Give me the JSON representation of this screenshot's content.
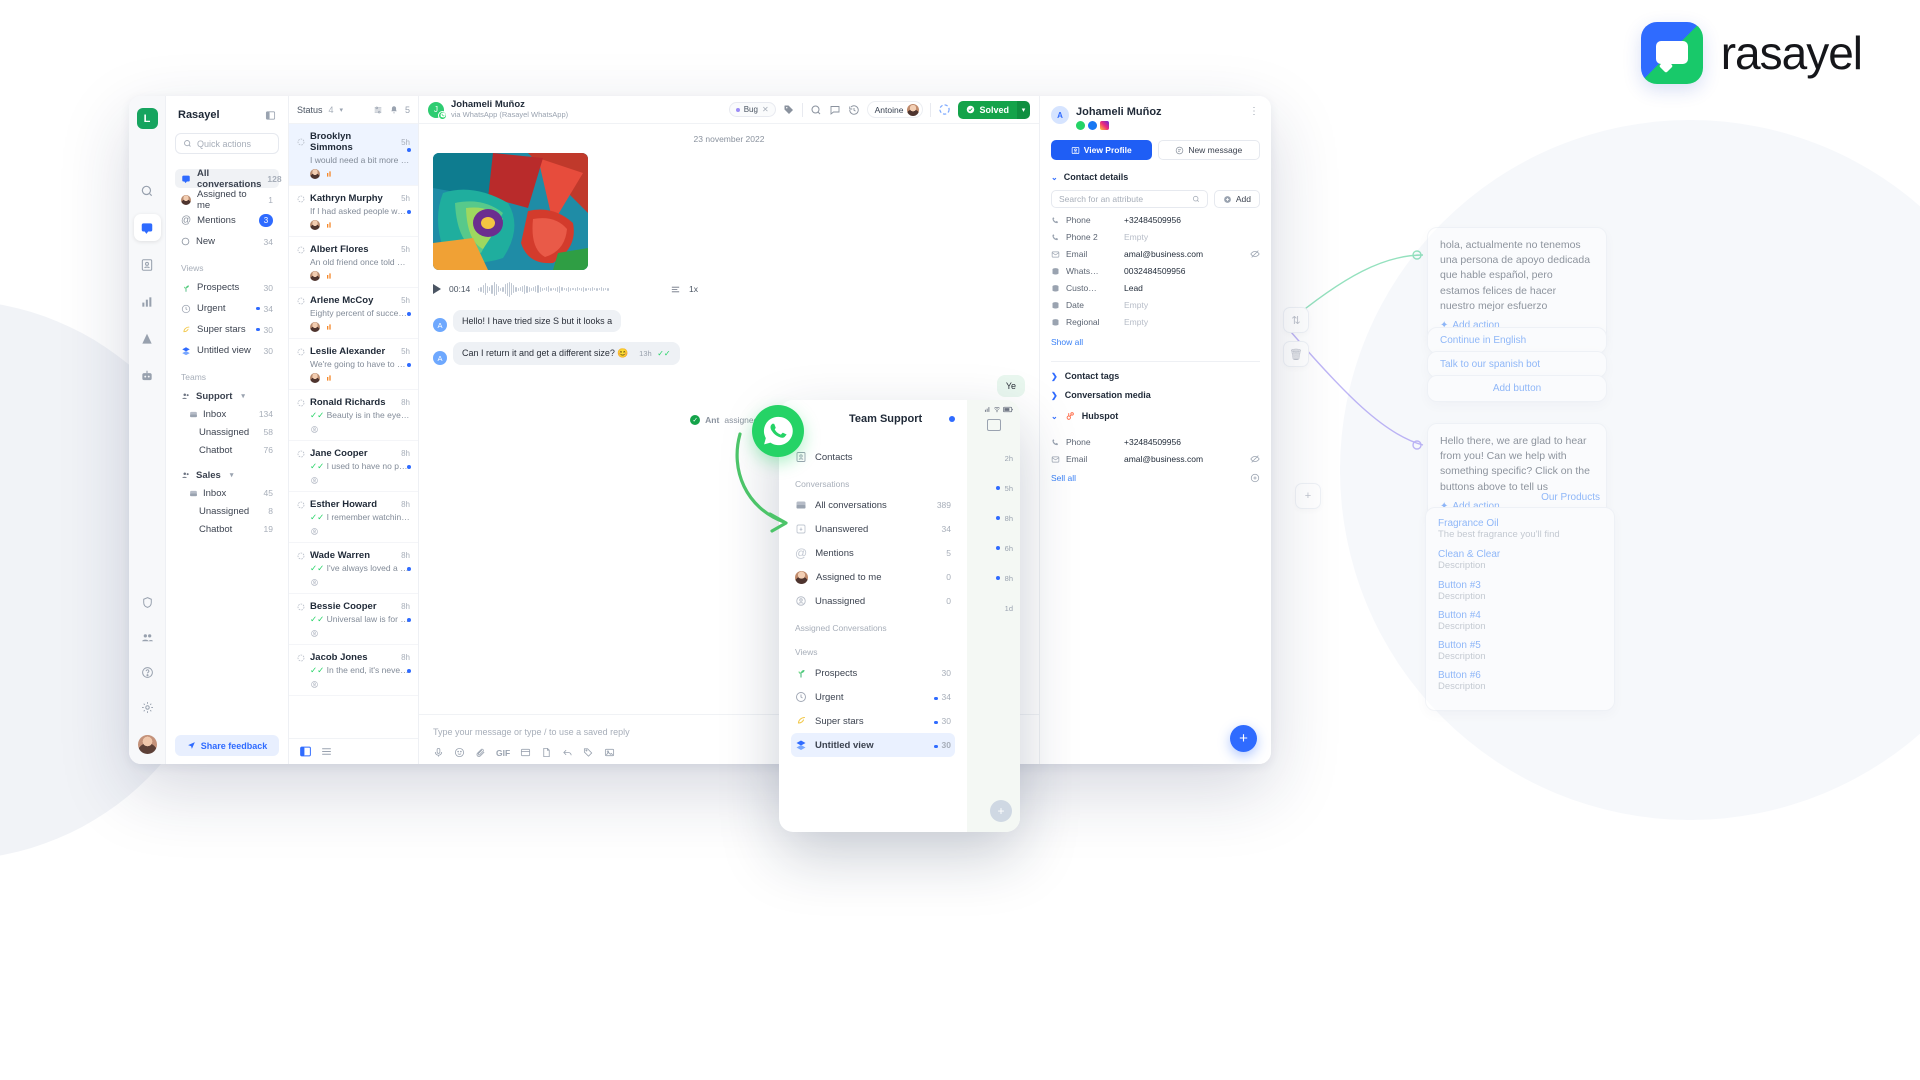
{
  "brand": {
    "name": "rasayel",
    "logo_letter": "L"
  },
  "rail": {
    "logo_letter": "L",
    "items": [
      {
        "name": "search-icon",
        "label": "Search"
      },
      {
        "name": "inbox-icon",
        "label": "Inbox",
        "active": true
      },
      {
        "name": "contacts-icon",
        "label": "Contacts"
      },
      {
        "name": "reports-icon",
        "label": "Reports"
      },
      {
        "name": "campaigns-icon",
        "label": "Campaigns"
      },
      {
        "name": "bot-icon",
        "label": "Bots"
      }
    ],
    "bottom": [
      {
        "name": "shield-icon",
        "label": "Privacy"
      },
      {
        "name": "team-icon",
        "label": "Team"
      },
      {
        "name": "help-icon",
        "label": "Help"
      },
      {
        "name": "gear-icon",
        "label": "Settings"
      }
    ]
  },
  "nav": {
    "title": "Rasayel",
    "collapse_icon": "panel-collapse-icon",
    "search_placeholder": "Quick actions",
    "primary": [
      {
        "label": "All conversations",
        "count": "128",
        "selected": true,
        "icon": "inbox-icon"
      },
      {
        "label": "Assigned to me",
        "count": "1",
        "icon": "avatar-icon"
      },
      {
        "label": "Mentions",
        "badge": "3",
        "icon": "at-icon"
      },
      {
        "label": "New",
        "count": "34",
        "icon": "circle-icon"
      }
    ],
    "views_label": "Views",
    "views": [
      {
        "label": "Prospects",
        "count": "30",
        "icon": "sprout-icon",
        "dot": false
      },
      {
        "label": "Urgent",
        "count": "34",
        "icon": "clock-icon",
        "dot": true
      },
      {
        "label": "Super stars",
        "count": "30",
        "icon": "comet-icon",
        "dot": true
      },
      {
        "label": "Untitled view",
        "count": "30",
        "icon": "layers-icon",
        "dot": false
      }
    ],
    "teams_label": "Teams",
    "teams": [
      {
        "name": "Support",
        "children": [
          {
            "label": "Inbox",
            "count": "134",
            "icon": "inbox-icon"
          },
          {
            "label": "Unassigned",
            "count": "58"
          },
          {
            "label": "Chatbot",
            "count": "76"
          }
        ]
      },
      {
        "name": "Sales",
        "children": [
          {
            "label": "Inbox",
            "count": "45",
            "icon": "inbox-icon"
          },
          {
            "label": "Unassigned",
            "count": "8"
          },
          {
            "label": "Chatbot",
            "count": "19"
          }
        ]
      }
    ],
    "feedback_label": "Share feedback"
  },
  "conversations": {
    "status_label": "Status",
    "status_count": "4",
    "filter_icon": "filter-icon",
    "bell_icon": "bell-icon",
    "bell_count": "5",
    "items": [
      {
        "name": "Brooklyn Simmons",
        "preview": "I would need a bit more information if that's…",
        "time": "5h",
        "active": true,
        "unread": true,
        "sent": false
      },
      {
        "name": "Kathryn Murphy",
        "preview": "If I had asked people what they wanted, the…",
        "time": "5h",
        "unread": true,
        "sent": false
      },
      {
        "name": "Albert Flores",
        "preview": "An old friend once told me something that…",
        "time": "5h",
        "unread": false,
        "sent": false
      },
      {
        "name": "Arlene McCoy",
        "preview": "Eighty percent of success is showing up",
        "time": "5h",
        "unread": true,
        "sent": false
      },
      {
        "name": "Leslie Alexander",
        "preview": "We're going to have to get jobs, to cover up…",
        "time": "5h",
        "unread": true,
        "sent": false
      },
      {
        "name": "Ronald Richards",
        "preview": "Beauty is in the eye of the beholder",
        "time": "8h",
        "unread": false,
        "sent": true
      },
      {
        "name": "Jane Cooper",
        "preview": "I used to have no pubic hair when this son…",
        "time": "8h",
        "unread": true,
        "sent": true
      },
      {
        "name": "Esther Howard",
        "preview": "I remember watching this footage when it…",
        "time": "8h",
        "unread": false,
        "sent": true
      },
      {
        "name": "Wade Warren",
        "preview": "I've always loved a good story. I believed…",
        "time": "8h",
        "unread": true,
        "sent": true
      },
      {
        "name": "Bessie Cooper",
        "preview": "Universal law is for lackeys, context is for…",
        "time": "8h",
        "unread": true,
        "sent": true
      },
      {
        "name": "Jacob Jones",
        "preview": "In the end, it's never what you worry abou…",
        "time": "8h",
        "unread": true,
        "sent": true
      }
    ]
  },
  "chat": {
    "contact_name": "Johameli Muñoz",
    "channel": "via WhatsApp (Rasayel WhatsApp)",
    "avatar_letter": "J",
    "tag": {
      "label": "Bug",
      "close_icon": "close-icon"
    },
    "toolbar_icons": [
      "tag-icon",
      "search-icon",
      "note-icon",
      "history-icon"
    ],
    "agent": {
      "name": "Antoine"
    },
    "refresh_icon": "loading-icon",
    "status_button": {
      "label": "Solved",
      "caret": "▾"
    },
    "date_divider": "23 november 2022",
    "voice": {
      "duration": "00:14",
      "speed": "1x"
    },
    "messages": [
      {
        "from": "in",
        "avatar": "A",
        "text": "Hello! I have tried size S but it looks a"
      },
      {
        "from": "in",
        "avatar": "A",
        "text": "Can I return it and get a different size? 😊",
        "time": "13h"
      },
      {
        "from": "out",
        "text": "Ye"
      }
    ],
    "system_note": {
      "bold": "Ant",
      "rest": "assigned th"
    },
    "composer_placeholder": "Type your message or type / to use a saved reply",
    "composer_icons": [
      "mic-icon",
      "emoji-icon",
      "attach-icon",
      "gif-icon",
      "template-icon",
      "doc-icon",
      "reply-icon",
      "tag-icon",
      "image-icon"
    ],
    "fab_icon": "plus-icon"
  },
  "contact_panel": {
    "name": "Johameli Muñoz",
    "avatar_letter": "A",
    "socials": [
      "whatsapp-icon",
      "facebook-icon",
      "instagram-icon"
    ],
    "menu_icon": "kebab-menu-icon",
    "view_profile": "View Profile",
    "new_message": "New message",
    "details_label": "Contact details",
    "attribute_search_placeholder": "Search for an attribute",
    "add_label": "Add",
    "attributes": [
      {
        "key": "Phone",
        "value": "+32484509956",
        "icon": "phone-icon"
      },
      {
        "key": "Phone 2",
        "value": "Empty",
        "empty": true,
        "icon": "phone-icon"
      },
      {
        "key": "Email",
        "value": "amal@business.com",
        "icon": "mail-icon",
        "eye": true
      },
      {
        "key": "Whats…",
        "value": "0032484509956",
        "icon": "db-icon"
      },
      {
        "key": "Custo…",
        "value": "Lead",
        "icon": "db-icon"
      },
      {
        "key": "Date",
        "value": "Empty",
        "empty": true,
        "icon": "db-icon"
      },
      {
        "key": "Regional",
        "value": "Empty",
        "empty": true,
        "icon": "db-icon"
      }
    ],
    "show_all": "Show all",
    "sections": [
      {
        "label": "Contact tags",
        "open": false
      },
      {
        "label": "Conversation media",
        "open": false
      }
    ],
    "hubspot": {
      "label": "Hubspot",
      "attributes": [
        {
          "key": "Phone",
          "value": "+32484509956",
          "icon": "phone-icon"
        },
        {
          "key": "Email",
          "value": "amal@business.com",
          "icon": "mail-icon",
          "eye": true
        }
      ],
      "sell_all": "Sell all"
    }
  },
  "overlay": {
    "title": "Team Support",
    "wa_icon": "whatsapp-icon",
    "contacts_label": "Contacts",
    "conversations_label": "Conversations",
    "conversations": [
      {
        "label": "All conversations",
        "count": "389",
        "icon": "inbox-icon"
      },
      {
        "label": "Unanswered",
        "count": "34",
        "icon": "unanswered-icon"
      },
      {
        "label": "Mentions",
        "count": "5",
        "icon": "at-icon"
      },
      {
        "label": "Assigned to me",
        "count": "0",
        "icon": "avatar-icon"
      },
      {
        "label": "Unassigned",
        "count": "0",
        "icon": "user-circle-icon"
      }
    ],
    "assigned_label": "Assigned Conversations",
    "views_label": "Views",
    "views": [
      {
        "label": "Prospects",
        "count": "30",
        "icon": "sprout-icon",
        "dot": false
      },
      {
        "label": "Urgent",
        "count": "34",
        "icon": "clock-icon",
        "dot": true
      },
      {
        "label": "Super stars",
        "count": "30",
        "icon": "comet-icon",
        "dot": true
      },
      {
        "label": "Untitled view",
        "count": "30",
        "icon": "layers-icon",
        "dot": true,
        "selected": true
      }
    ],
    "strip_times": [
      "2h",
      "5h",
      "8h",
      "6h",
      "8h",
      "1d"
    ],
    "fab_icon": "plus-icon"
  },
  "flow": {
    "cards": [
      {
        "text": "hola, actualmente no tenemos una persona de apoyo dedicada que hable español, pero estamos felices de hacer nuestro mejor esfuerzo",
        "link": "Add action",
        "type": "msg"
      },
      {
        "text": "",
        "link": "Continue in English",
        "type": "opt"
      },
      {
        "text": "",
        "link": "Talk to our spanish bot",
        "type": "opt"
      },
      {
        "text": "",
        "link": "Add button",
        "type": "add"
      },
      {
        "text": "Hello there, we are glad to hear from you! Can we help with something specific? Click on the buttons above to tell us",
        "link": "Add action",
        "type": "msg"
      }
    ],
    "products_label": "Our Products",
    "products": [
      {
        "title": "Fragrance Oil",
        "desc": "The best fragrance you'll find"
      },
      {
        "title": "Clean & Clear",
        "desc": "Description"
      }
    ],
    "buttons": [
      {
        "title": "Button #3",
        "desc": "Description"
      },
      {
        "title": "Button #4",
        "desc": "Description"
      },
      {
        "title": "Button #5",
        "desc": "Description"
      },
      {
        "title": "Button #6",
        "desc": "Description"
      }
    ]
  }
}
